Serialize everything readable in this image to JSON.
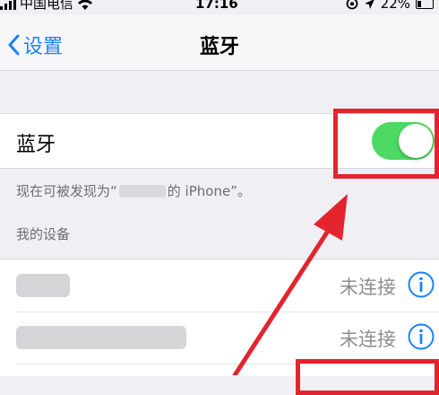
{
  "status_bar": {
    "carrier": "中国电信",
    "time": "17:16",
    "battery": "22%"
  },
  "nav": {
    "back_label": "设置",
    "title": "蓝牙"
  },
  "bluetooth": {
    "label": "蓝牙",
    "toggle_on": true
  },
  "discoverable": {
    "prefix": "现在可被发现为“",
    "suffix": "的 iPhone”。"
  },
  "my_devices": {
    "header": "我的设备",
    "devices": [
      {
        "status": "未连接"
      },
      {
        "status": "未连接"
      }
    ]
  },
  "colors": {
    "accent": "#1a82fb",
    "toggle_on": "#4cd964",
    "annotation": "#e3242e"
  },
  "icons": [
    "wifi-icon",
    "location-icon",
    "back-chevron-icon",
    "info-icon",
    "battery-icon",
    "signal-icon"
  ]
}
